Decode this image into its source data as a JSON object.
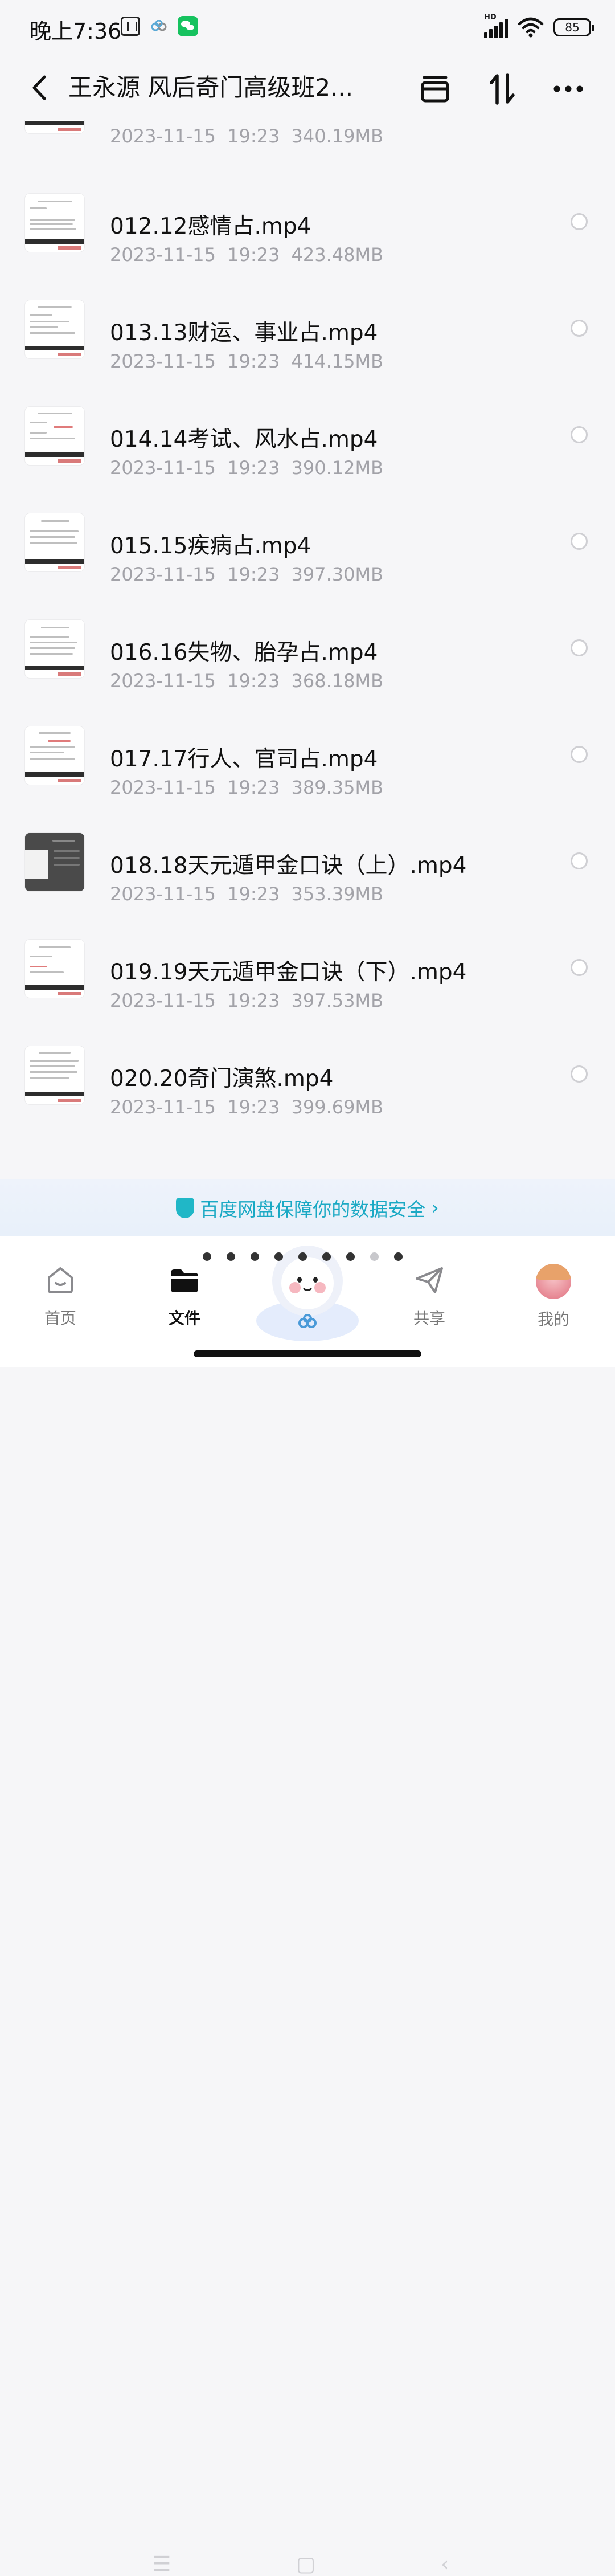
{
  "status_bar": {
    "time": "晚上7:36",
    "network": "HD",
    "battery": "85"
  },
  "header": {
    "title": "王永源 风后奇门高级班2..."
  },
  "files": [
    {
      "name": "",
      "date": "2023-11-15",
      "time": "19:23",
      "size": "340.19MB"
    },
    {
      "name": "012.12感情占.mp4",
      "date": "2023-11-15",
      "time": "19:23",
      "size": "423.48MB"
    },
    {
      "name": "013.13财运、事业占.mp4",
      "date": "2023-11-15",
      "time": "19:23",
      "size": "414.15MB"
    },
    {
      "name": "014.14考试、风水占.mp4",
      "date": "2023-11-15",
      "time": "19:23",
      "size": "390.12MB"
    },
    {
      "name": "015.15疾病占.mp4",
      "date": "2023-11-15",
      "time": "19:23",
      "size": "397.30MB"
    },
    {
      "name": "016.16失物、胎孕占.mp4",
      "date": "2023-11-15",
      "time": "19:23",
      "size": "368.18MB"
    },
    {
      "name": "017.17行人、官司占.mp4",
      "date": "2023-11-15",
      "time": "19:23",
      "size": "389.35MB"
    },
    {
      "name": "018.18天元遁甲金口诀（上）.mp4",
      "date": "2023-11-15",
      "time": "19:23",
      "size": "353.39MB"
    },
    {
      "name": "019.19天元遁甲金口诀（下）.mp4",
      "date": "2023-11-15",
      "time": "19:23",
      "size": "397.53MB"
    },
    {
      "name": "020.20奇门演煞.mp4",
      "date": "2023-11-15",
      "time": "19:23",
      "size": "399.69MB"
    }
  ],
  "banner": {
    "text": "百度网盘保障你的数据安全"
  },
  "tabbar": {
    "home": "首页",
    "files": "文件",
    "share": "共享",
    "mine": "我的"
  },
  "colors": {
    "accent": "#1aa9c4",
    "meta_gray": "#a2a2a8"
  }
}
